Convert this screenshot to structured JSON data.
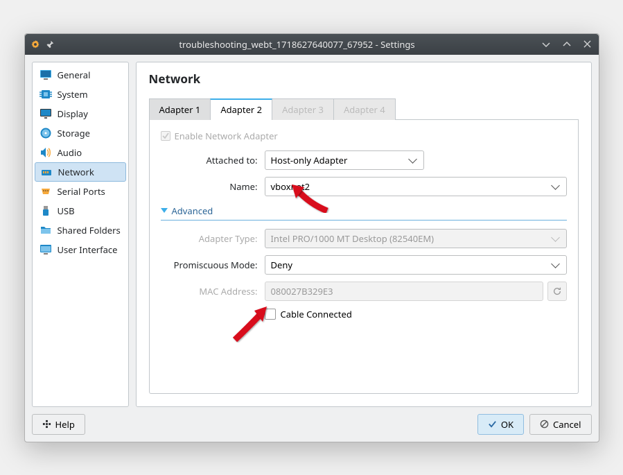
{
  "window": {
    "title": "troubleshooting_webt_1718627640077_67952 - Settings"
  },
  "sidebar": {
    "items": [
      {
        "label": "General"
      },
      {
        "label": "System"
      },
      {
        "label": "Display"
      },
      {
        "label": "Storage"
      },
      {
        "label": "Audio"
      },
      {
        "label": "Network"
      },
      {
        "label": "Serial Ports"
      },
      {
        "label": "USB"
      },
      {
        "label": "Shared Folders"
      },
      {
        "label": "User Interface"
      }
    ]
  },
  "main": {
    "heading": "Network",
    "tabs": [
      {
        "label": "Adapter 1"
      },
      {
        "label": "Adapter 2"
      },
      {
        "label": "Adapter 3"
      },
      {
        "label": "Adapter 4"
      }
    ],
    "enableAdapterLabel": "Enable Network Adapter",
    "attachedToLabel": "Attached to:",
    "attachedToValue": "Host-only Adapter",
    "nameLabel": "Name:",
    "nameValue": "vboxnet2",
    "advancedLabel": "Advanced",
    "adapterTypeLabel": "Adapter Type:",
    "adapterTypeValue": "Intel PRO/1000 MT Desktop (82540EM)",
    "promiscuousLabel": "Promiscuous Mode:",
    "promiscuousValue": "Deny",
    "macLabel": "MAC Address:",
    "macValue": "080027B329E3",
    "cableLabel": "Cable Connected"
  },
  "footer": {
    "help": "Help",
    "ok": "OK",
    "cancel": "Cancel"
  }
}
